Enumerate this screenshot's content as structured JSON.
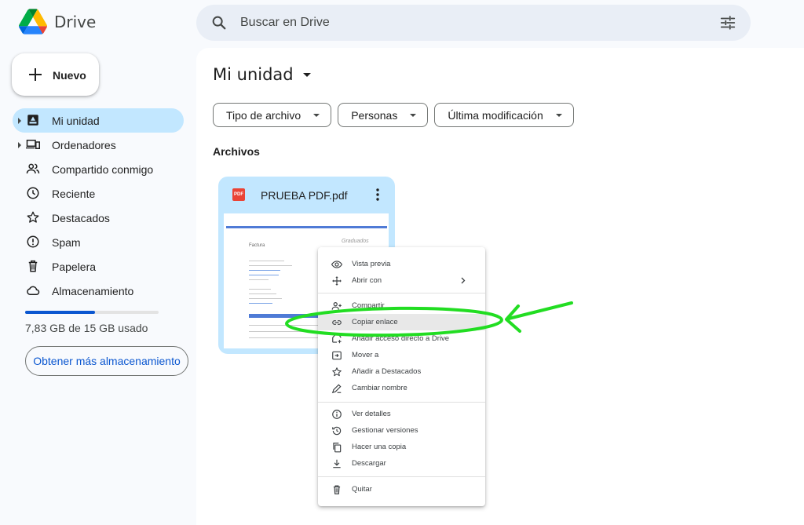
{
  "app": {
    "name": "Drive"
  },
  "search": {
    "placeholder": "Buscar en Drive"
  },
  "sidebar": {
    "new_label": "Nuevo",
    "items": [
      {
        "label": "Mi unidad"
      },
      {
        "label": "Ordenadores"
      },
      {
        "label": "Compartido conmigo"
      },
      {
        "label": "Reciente"
      },
      {
        "label": "Destacados"
      },
      {
        "label": "Spam"
      },
      {
        "label": "Papelera"
      },
      {
        "label": "Almacenamiento"
      }
    ],
    "storage": {
      "used_text": "7,83 GB de 15 GB usado",
      "fraction": 0.522
    },
    "more_storage_label": "Obtener más almacenamiento"
  },
  "main": {
    "title": "Mi unidad",
    "filters": [
      "Tipo de archivo",
      "Personas",
      "Última modificación"
    ],
    "section_label": "Archivos",
    "file": {
      "name": "PRUEBA PDF.pdf",
      "badge": "PDF",
      "thumb_heading": "Factura",
      "thumb_signature": "Graduados"
    }
  },
  "context_menu": {
    "items": [
      {
        "label": "Vista previa",
        "icon": "eye-icon"
      },
      {
        "label": "Abrir con",
        "icon": "move-arrows-icon"
      },
      {
        "label": "Compartir",
        "icon": "person-add-icon"
      },
      {
        "label": "Copiar enlace",
        "icon": "link-icon"
      },
      {
        "label": "Añadir acceso directo a Drive",
        "icon": "shortcut-icon"
      },
      {
        "label": "Mover a",
        "icon": "drive-move-icon"
      },
      {
        "label": "Añadir a Destacados",
        "icon": "star-icon"
      },
      {
        "label": "Cambiar nombre",
        "icon": "pencil-icon"
      },
      {
        "label": "Ver detalles",
        "icon": "info-icon"
      },
      {
        "label": "Gestionar versiones",
        "icon": "history-icon"
      },
      {
        "label": "Hacer una copia",
        "icon": "copy-icon"
      },
      {
        "label": "Descargar",
        "icon": "download-icon"
      },
      {
        "label": "Quitar",
        "icon": "trash-icon"
      }
    ]
  },
  "colors": {
    "accent": "#0b57d0",
    "selected": "#c2e7ff",
    "annotation": "#22dd22"
  }
}
